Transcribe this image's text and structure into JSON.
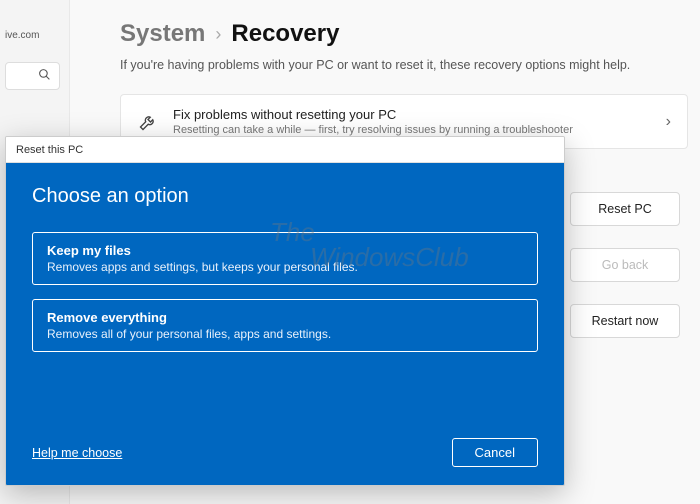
{
  "sidebar": {
    "email_fragment": "ive.com"
  },
  "breadcrumb": {
    "parent": "System",
    "sep": "›",
    "current": "Recovery"
  },
  "subtitle": "If you're having problems with your PC or want to reset it, these recovery options might help.",
  "troubleshoot_card": {
    "title": "Fix problems without resetting your PC",
    "subtitle": "Resetting can take a while — first, try resolving issues by running a troubleshooter"
  },
  "buttons": {
    "reset_pc": "Reset PC",
    "go_back": "Go back",
    "restart_now": "Restart now"
  },
  "dialog": {
    "titlebar": "Reset this PC",
    "heading": "Choose an option",
    "options": [
      {
        "title": "Keep my files",
        "desc": "Removes apps and settings, but keeps your personal files."
      },
      {
        "title": "Remove everything",
        "desc": "Removes all of your personal files, apps and settings."
      }
    ],
    "help_link": "Help me choose",
    "cancel": "Cancel"
  },
  "watermark": {
    "line1": "The",
    "line2": "WindowsClub"
  }
}
